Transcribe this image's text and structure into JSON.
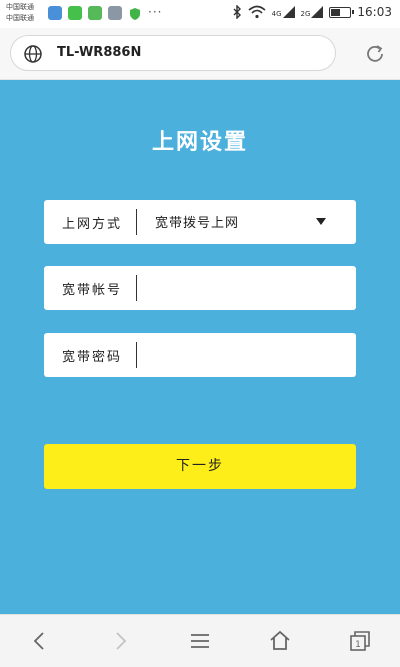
{
  "status_bar": {
    "carrier_line1": "中国联通",
    "carrier_line2": "中国联通",
    "network1": "4G",
    "network2": "2G",
    "time": "16:03",
    "battery_level": 0.55,
    "icons": [
      "app-icon-1",
      "wechat-icon",
      "app-icon-3",
      "image-icon",
      "shield-icon",
      "more-dots-icon",
      "bluetooth-icon",
      "wifi-icon",
      "signal-icon",
      "battery-icon"
    ]
  },
  "address_bar": {
    "url": "TL-WR886N",
    "icons": [
      "globe-icon",
      "reload-icon"
    ]
  },
  "page": {
    "title": "上网设置",
    "fields": [
      {
        "label": "上网方式",
        "value": "宽带拨号上网"
      },
      {
        "label": "宽带帐号",
        "value": ""
      },
      {
        "label": "宽带密码",
        "value": ""
      }
    ],
    "next_button": "下一步"
  },
  "colors": {
    "background": "#4bb0dc",
    "button": "#fded18",
    "field_bg": "#ffffff"
  },
  "bottom_nav": {
    "icons": [
      "back-icon",
      "forward-icon",
      "menu-icon",
      "home-icon",
      "tabs-icon"
    ],
    "tabs_count": "1"
  }
}
